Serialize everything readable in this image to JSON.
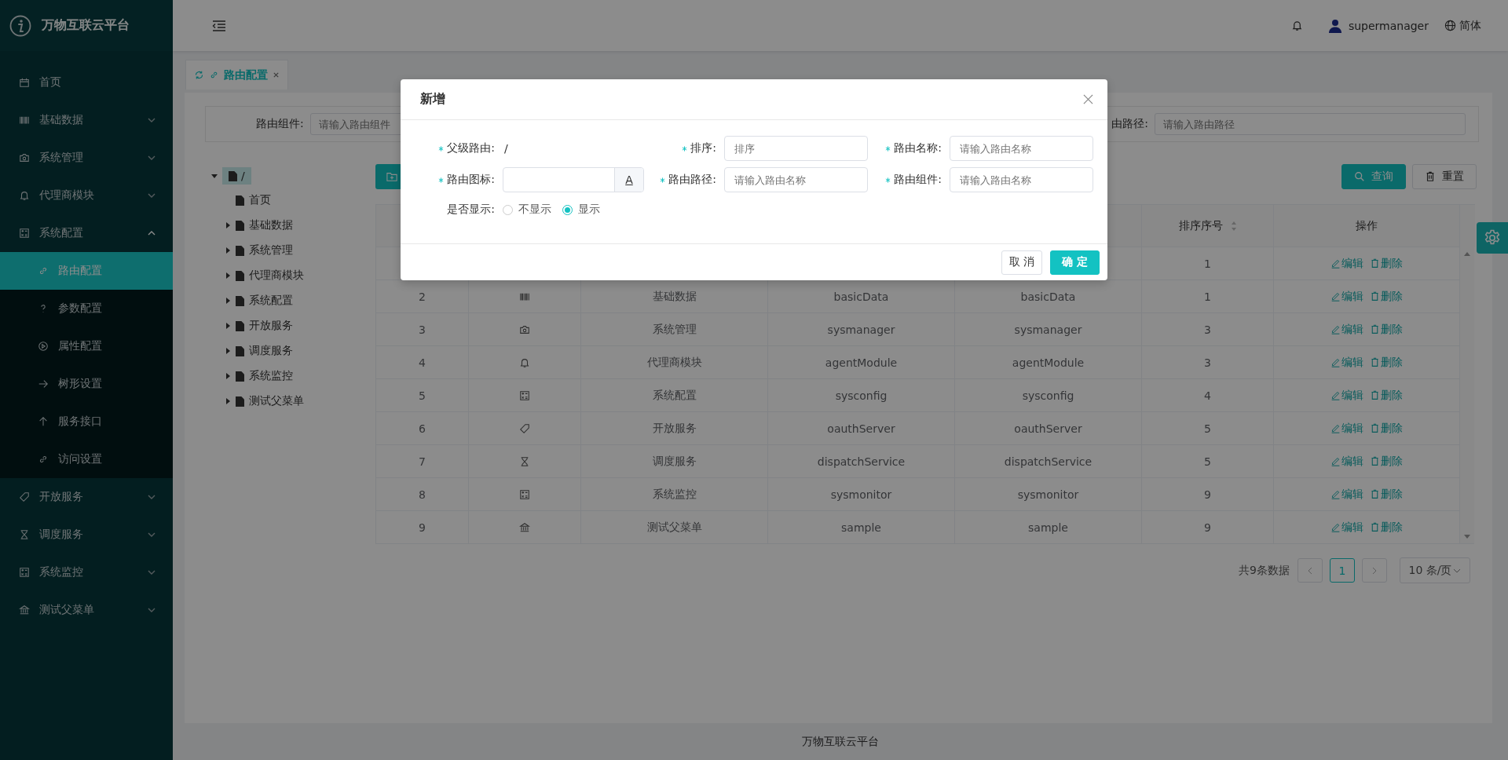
{
  "sidebar": {
    "logo": "万物互联云平台",
    "items": [
      {
        "label": "首页",
        "kind": "link"
      },
      {
        "label": "基础数据",
        "kind": "submenu",
        "expanded": false
      },
      {
        "label": "系统管理",
        "kind": "submenu",
        "expanded": false
      },
      {
        "label": "代理商模块",
        "kind": "submenu",
        "expanded": false
      },
      {
        "label": "系统配置",
        "kind": "submenu",
        "expanded": true,
        "children": [
          {
            "label": "路由配置",
            "selected": true
          },
          {
            "label": "参数配置",
            "selected": false
          },
          {
            "label": "属性配置",
            "selected": false
          },
          {
            "label": "树形设置",
            "selected": false
          },
          {
            "label": "服务接口",
            "selected": false
          },
          {
            "label": "访问设置",
            "selected": false
          }
        ]
      },
      {
        "label": "开放服务",
        "kind": "submenu",
        "expanded": false
      },
      {
        "label": "调度服务",
        "kind": "submenu",
        "expanded": false
      },
      {
        "label": "系统监控",
        "kind": "submenu",
        "expanded": false
      },
      {
        "label": "测试父菜单",
        "kind": "submenu",
        "expanded": false
      }
    ]
  },
  "header": {
    "user": "supermanager",
    "language": "简体"
  },
  "tabs": [
    {
      "label": "路由配置",
      "selected": true
    }
  ],
  "search": {
    "fields": [
      {
        "label": "路由组件:",
        "placeholder": "请输入路由组件"
      },
      {
        "label": "由路径:",
        "placeholder": "请输入路由路径"
      }
    ]
  },
  "toolbar": {
    "buttons": [
      {
        "label": "查询",
        "kind": "primary"
      },
      {
        "label": "重置",
        "kind": "default"
      }
    ]
  },
  "tree": {
    "root": {
      "label": "/",
      "selected": true,
      "expanded": true,
      "children": [
        {
          "label": "首页",
          "kind": "leaf"
        },
        {
          "label": "基础数据",
          "kind": "folder",
          "expanded": false
        },
        {
          "label": "系统管理",
          "kind": "folder",
          "expanded": false
        },
        {
          "label": "代理商模块",
          "kind": "folder",
          "expanded": false
        },
        {
          "label": "系统配置",
          "kind": "folder",
          "expanded": false
        },
        {
          "label": "开放服务",
          "kind": "folder",
          "expanded": false
        },
        {
          "label": "调度服务",
          "kind": "folder",
          "expanded": false
        },
        {
          "label": "系统监控",
          "kind": "folder",
          "expanded": false
        },
        {
          "label": "测试父菜单",
          "kind": "folder",
          "expanded": false
        }
      ]
    }
  },
  "table": {
    "columns": [
      "排序序号",
      "操作"
    ],
    "rows": [
      {
        "sort": "1",
        "actions": [
          "编辑",
          "删除"
        ]
      },
      {
        "index": "2",
        "name": "基础数据",
        "path": "basicData",
        "component": "basicData",
        "sort": "1",
        "actions": [
          "编辑",
          "删除"
        ]
      },
      {
        "index": "3",
        "name": "系统管理",
        "path": "sysmanager",
        "component": "sysmanager",
        "sort": "3",
        "actions": [
          "编辑",
          "删除"
        ]
      },
      {
        "index": "4",
        "name": "代理商模块",
        "path": "agentModule",
        "component": "agentModule",
        "sort": "3",
        "actions": [
          "编辑",
          "删除"
        ]
      },
      {
        "index": "5",
        "name": "系统配置",
        "path": "sysconfig",
        "component": "sysconfig",
        "sort": "4",
        "actions": [
          "编辑",
          "删除"
        ]
      },
      {
        "index": "6",
        "name": "开放服务",
        "path": "oauthServer",
        "component": "oauthServer",
        "sort": "5",
        "actions": [
          "编辑",
          "删除"
        ]
      },
      {
        "index": "7",
        "name": "调度服务",
        "path": "dispatchService",
        "component": "dispatchService",
        "sort": "5",
        "actions": [
          "编辑",
          "删除"
        ]
      },
      {
        "index": "8",
        "name": "系统监控",
        "path": "sysmonitor",
        "component": "sysmonitor",
        "sort": "9",
        "actions": [
          "编辑",
          "删除"
        ]
      },
      {
        "index": "9",
        "name": "测试父菜单",
        "path": "sample",
        "component": "sample",
        "sort": "9",
        "actions": [
          "编辑",
          "删除"
        ]
      }
    ]
  },
  "pagination": {
    "total": "共9条数据",
    "pages": [
      {
        "label": "1",
        "selected": true
      }
    ],
    "page_size": "10 条/页"
  },
  "footer": "万物互联云平台",
  "dialog": {
    "title": "新增",
    "fields": [
      {
        "label": "父级路由:",
        "required": true,
        "kind": "static",
        "value": "/"
      },
      {
        "label": "排序:",
        "required": true,
        "kind": "input",
        "placeholder": "排序"
      },
      {
        "label": "路由名称:",
        "required": true,
        "kind": "input",
        "placeholder": "请输入路由名称"
      },
      {
        "label": "路由图标:",
        "required": true,
        "kind": "icon-input",
        "button": "A"
      },
      {
        "label": "路由路径:",
        "required": true,
        "kind": "input",
        "placeholder": "请输入路由名称"
      },
      {
        "label": "路由组件:",
        "required": true,
        "kind": "input",
        "placeholder": "请输入路由名称"
      },
      {
        "label": "是否显示:",
        "required": false,
        "kind": "radio",
        "options": [
          {
            "label": "不显示",
            "selected": false
          },
          {
            "label": "显示",
            "selected": true
          }
        ]
      }
    ],
    "buttons": [
      {
        "label": "取 消",
        "kind": "default"
      },
      {
        "label": "确 定",
        "kind": "primary"
      }
    ]
  }
}
